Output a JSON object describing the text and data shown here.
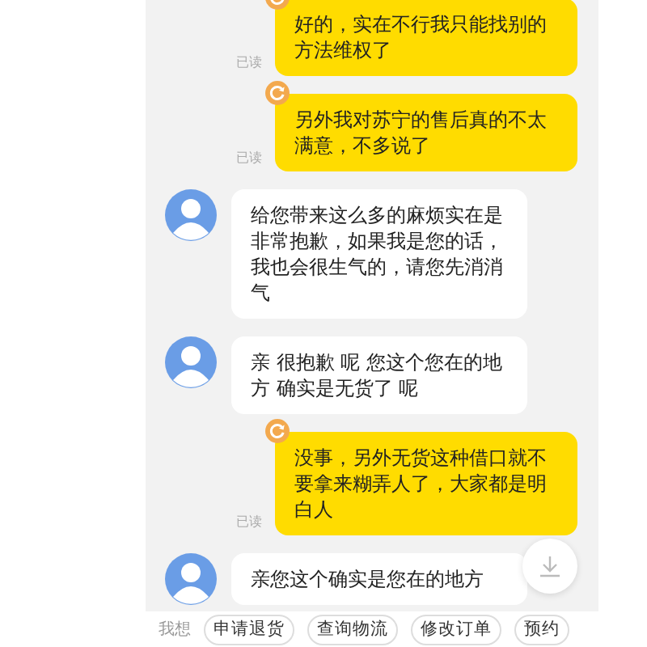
{
  "messages": [
    {
      "kind": "sent",
      "text": "好的，实在不行我只能找别的方法维权了",
      "status": "已读"
    },
    {
      "kind": "sent",
      "text": "另外我对苏宁的售后真的不太满意，不多说了",
      "status": "已读"
    },
    {
      "kind": "received",
      "text": "给您带来这么多的麻烦实在是非常抱歉，如果我是您的话，我也会很生气的，请您先消消气"
    },
    {
      "kind": "received",
      "text": "亲 很抱歉 呢 您这个您在的地方 确实是无货了 呢"
    },
    {
      "kind": "sent",
      "text": "没事，另外无货这种借口就不要拿来糊弄人了，大家都是明白人",
      "status": "已读"
    },
    {
      "kind": "received",
      "text": "亲您这个确实是您在的地方"
    }
  ],
  "quick_replies": {
    "label": "我想",
    "chips": [
      "申请退货",
      "查询物流",
      "修改订单",
      "预约"
    ]
  }
}
